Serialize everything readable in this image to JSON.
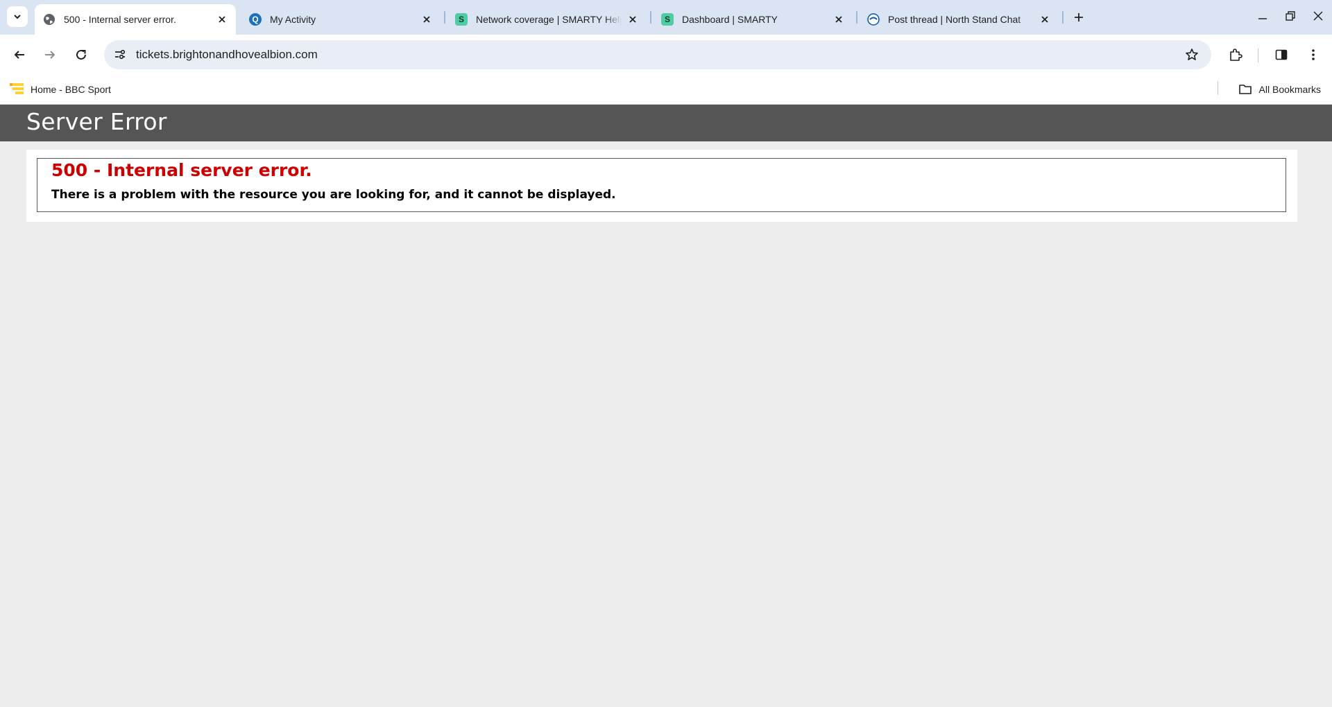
{
  "browser": {
    "tabs": [
      {
        "title": "500 - Internal server error.",
        "favicon": "globe-icon",
        "active": true
      },
      {
        "title": "My Activity",
        "favicon": "q-logo-icon",
        "active": false
      },
      {
        "title": "Network coverage | SMARTY Help",
        "favicon": "smarty-s-icon",
        "active": false
      },
      {
        "title": "Dashboard | SMARTY",
        "favicon": "smarty-s-icon",
        "active": false
      },
      {
        "title": "Post thread | North Stand Chat",
        "favicon": "north-stand-chat-icon",
        "active": false
      }
    ],
    "url": "tickets.brightonandhovealbion.com",
    "bookmarks": [
      {
        "label": "Home - BBC Sport",
        "favicon": "bbc-sport-icon"
      }
    ],
    "all_bookmarks_label": "All Bookmarks",
    "colors": {
      "tabstrip": "#dbe4f3",
      "omnibox": "#e9eef6"
    }
  },
  "page": {
    "header_title": "Server Error",
    "error_heading": "500 - Internal server error.",
    "error_message": "There is a problem with the resource you are looking for, and it cannot be displayed.",
    "colors": {
      "header_bg": "#555555",
      "error_heading": "#cc0000",
      "page_bg": "#ededed"
    }
  }
}
